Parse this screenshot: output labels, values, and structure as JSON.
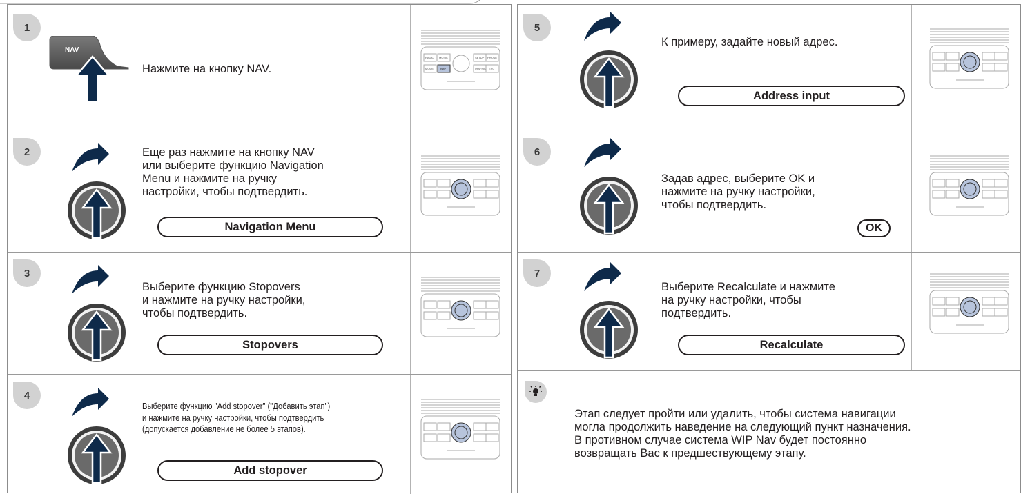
{
  "steps": [
    {
      "number": "1",
      "text_lines": [
        "Нажмите на кнопку NAV."
      ],
      "button_label": "NAV"
    },
    {
      "number": "2",
      "text_lines": [
        "Еще раз нажмите на кнопку NAV",
        "или выберите функцию Navigation",
        "Menu и нажмите на ручку",
        "настройки, чтобы подтвердить."
      ],
      "menu_label": "Navigation Menu"
    },
    {
      "number": "3",
      "text_lines": [
        "Выберите функцию Stopovers",
        "и нажмите на ручку настройки,",
        "чтобы подтвердить."
      ],
      "menu_label": "Stopovers"
    },
    {
      "number": "4",
      "text_lines": [
        "Выберите функцию \"Add stopover\" (\"Добавить этап\")",
        "и нажмите на ручку настройки, чтобы подтвердить",
        "(допускается добавление не более 5 этапов)."
      ],
      "menu_label": "Add stopover"
    },
    {
      "number": "5",
      "text_lines": [
        "К примеру, задайте новый адрес."
      ],
      "menu_label": "Address input"
    },
    {
      "number": "6",
      "text_lines": [
        "Задав адрес, выберите OK и",
        "нажмите на ручку настройки,",
        "чтобы подтвердить."
      ],
      "menu_label": "OK"
    },
    {
      "number": "7",
      "text_lines": [
        "Выберите Recalculate и нажмите",
        "на ручку настройки, чтобы",
        "подтвердить."
      ],
      "menu_label": "Recalculate"
    }
  ],
  "tip": {
    "icon": "lightbulb-icon",
    "text_lines": [
      "Этап следует пройти или удалить, чтобы система навигации",
      "могла продолжить наведение на следующий пункт назначения.",
      "В противном случае система WIP Nav будет постоянно",
      "возвращать Вас к предшествующему этапу."
    ]
  },
  "console": {
    "buttons": [
      "RADIO",
      "MUSIC",
      "SETUP",
      "PHONE",
      "MODE",
      "NAV",
      "TRAFFIC",
      "ESC"
    ]
  },
  "colors": {
    "arrow": "#0e2a4a",
    "knob_outer": "#3d3d3d",
    "badge": "#d2d2d2",
    "nav_highlight": "#b7c4dc"
  }
}
